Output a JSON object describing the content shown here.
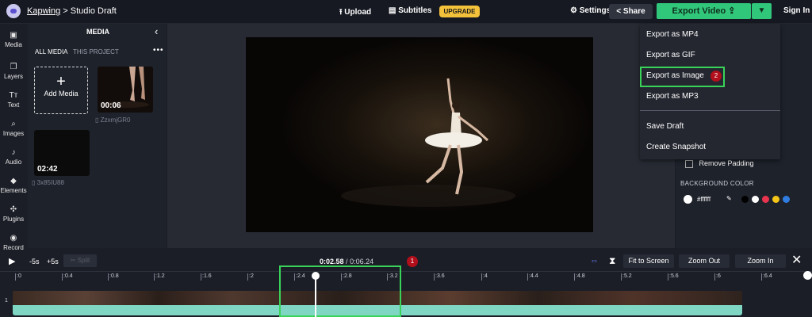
{
  "topbar": {
    "brand": "Kapwing",
    "separator": ">",
    "project_name": "Studio Draft",
    "upload_label": "Upload",
    "subtitles_label": "Subtitles",
    "upgrade_label": "UPGRADE",
    "settings_label": "Settings",
    "share_label": "Share",
    "export_label": "Export Video",
    "signin_label": "Sign In"
  },
  "leftnav": {
    "items": [
      {
        "label": "Media",
        "icon": "image-icon"
      },
      {
        "label": "Layers",
        "icon": "layers-icon"
      },
      {
        "label": "Text",
        "icon": "text-icon"
      },
      {
        "label": "Images",
        "icon": "search-icon"
      },
      {
        "label": "Audio",
        "icon": "music-note-icon"
      },
      {
        "label": "Elements",
        "icon": "shapes-icon"
      },
      {
        "label": "Plugins",
        "icon": "plugin-icon"
      },
      {
        "label": "Record",
        "icon": "record-icon"
      }
    ]
  },
  "media_panel": {
    "title": "MEDIA",
    "tab_all": "ALL MEDIA",
    "tab_project": "THIS PROJECT",
    "more": "•••",
    "add_media_label": "Add Media",
    "items": [
      {
        "duration": "00:06",
        "filename": "ZzxmjGR0"
      },
      {
        "duration": "02:42",
        "filename": "3x85IU88"
      }
    ]
  },
  "export_menu": {
    "items": [
      "Export as MP4",
      "Export as GIF",
      "Export as Image",
      "Export as MP3"
    ],
    "items2": [
      "Save Draft",
      "Create Snapshot"
    ],
    "badge": "2"
  },
  "right_panel": {
    "remove_padding_label": "Remove Padding",
    "background_color_label": "BACKGROUND COLOR",
    "color_value": "#ffffff",
    "swatches": [
      "#000000",
      "#ffffff",
      "#e8344e",
      "#f5c518",
      "#2f7de1"
    ]
  },
  "controls": {
    "back5": "-5s",
    "fwd5": "+5s",
    "split": "Split",
    "current_time": "0:02.58",
    "total_time": "0:06.24",
    "badge": "1",
    "fit_label": "Fit to Screen",
    "zoom_out_label": "Zoom Out",
    "zoom_in_label": "Zoom In"
  },
  "timeline": {
    "ticks": [
      ":0",
      ":0.4",
      ":0.8",
      ":1.2",
      ":1.6",
      ":2",
      ":2.4",
      ":2.8",
      ":3.2",
      ":3.6",
      ":4",
      ":4.4",
      ":4.8",
      ":5.2",
      ":5.6",
      ":6",
      ":6.4"
    ],
    "track_number": "1"
  },
  "colors": {
    "accent_green": "#31c77b",
    "upgrade_yellow": "#f4c13a",
    "highlight_green": "#3ad35a",
    "badge_red": "#b10f1b",
    "track_teal": "#7ed6c3"
  }
}
